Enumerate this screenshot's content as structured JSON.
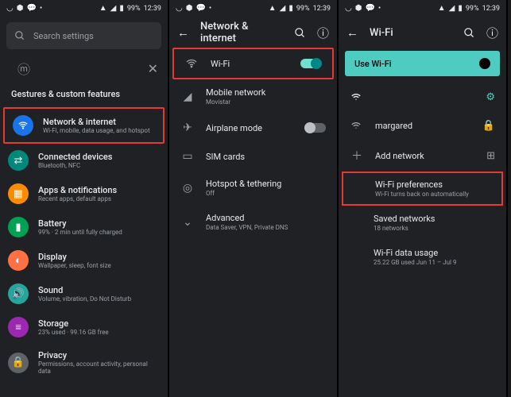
{
  "status": {
    "battery": "99%",
    "time": "12:39"
  },
  "panel1": {
    "search_placeholder": "Search settings",
    "section": "Gestures & custom features",
    "items": [
      {
        "title": "Network & internet",
        "sub": "Wi-Fi, mobile, data usage, and hotspot"
      },
      {
        "title": "Connected devices",
        "sub": "Bluetooth, NFC"
      },
      {
        "title": "Apps & notifications",
        "sub": "Recent apps, default apps"
      },
      {
        "title": "Battery",
        "sub": "99% · 2 min until fully charged"
      },
      {
        "title": "Display",
        "sub": "Wallpaper, sleep, font size"
      },
      {
        "title": "Sound",
        "sub": "Volume, vibration, Do Not Disturb"
      },
      {
        "title": "Storage",
        "sub": "23% used · 99.16 GB free"
      },
      {
        "title": "Privacy",
        "sub": "Permissions, account activity, personal data"
      }
    ]
  },
  "panel2": {
    "title": "Network & internet",
    "rows": [
      {
        "title": "Wi-Fi",
        "sub": ""
      },
      {
        "title": "Mobile network",
        "sub": "Movistar"
      },
      {
        "title": "Airplane mode",
        "sub": ""
      },
      {
        "title": "SIM cards",
        "sub": ""
      },
      {
        "title": "Hotspot & tethering",
        "sub": "Off"
      },
      {
        "title": "Advanced",
        "sub": "Data Saver, VPN, Private DNS"
      }
    ]
  },
  "panel3": {
    "title": "Wi-Fi",
    "use_wifi": "Use Wi-Fi",
    "net": "margared",
    "add": "Add network",
    "prefs": {
      "title": "Wi-Fi preferences",
      "sub": "Wi-Fi turns back on automatically"
    },
    "saved": {
      "title": "Saved networks",
      "sub": "18 networks"
    },
    "usage": {
      "title": "Wi-Fi data usage",
      "sub": "25.22 GB used Jun 11 – Jul 9"
    }
  }
}
